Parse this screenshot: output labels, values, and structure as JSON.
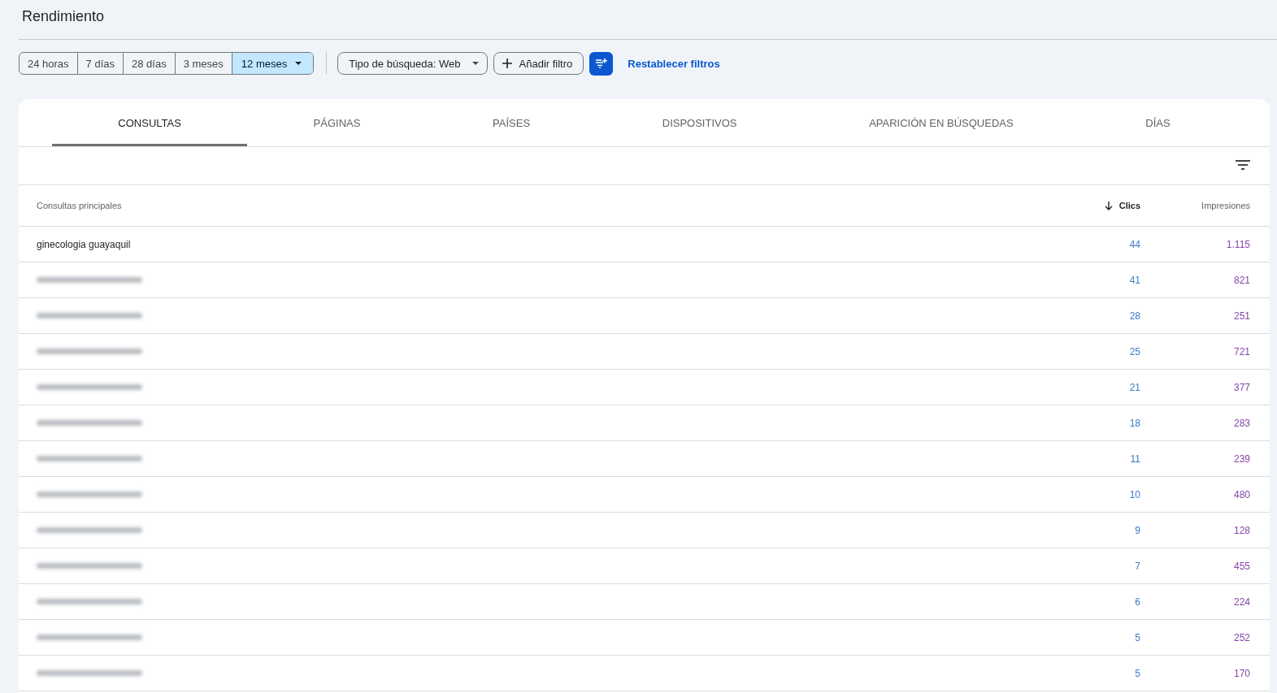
{
  "page": {
    "title": "Rendimiento"
  },
  "date_ranges": [
    {
      "label": "24 horas",
      "selected": false
    },
    {
      "label": "7 días",
      "selected": false
    },
    {
      "label": "28 días",
      "selected": false
    },
    {
      "label": "3 meses",
      "selected": false
    },
    {
      "label": "12 meses",
      "selected": true
    }
  ],
  "filters": [
    {
      "kind": "dropdown",
      "label": "Tipo de búsqueda: Web"
    },
    {
      "kind": "add",
      "label": "Añadir filtro"
    }
  ],
  "reset_link": "Restablecer filtros",
  "tabs": [
    {
      "label": "CONSULTAS",
      "selected": true
    },
    {
      "label": "PÁGINAS",
      "selected": false
    },
    {
      "label": "PAÍSES",
      "selected": false
    },
    {
      "label": "DISPOSITIVOS",
      "selected": false
    },
    {
      "label": "APARICIÓN EN BÚSQUEDAS",
      "selected": false
    },
    {
      "label": "DÍAS",
      "selected": false
    }
  ],
  "table": {
    "columns": [
      {
        "label": "Consultas principales",
        "sorted": false
      },
      {
        "label": "Clics",
        "sorted": true
      },
      {
        "label": "Impresiones",
        "sorted": false
      }
    ],
    "rows": [
      {
        "query": "ginecologia guayaquil",
        "blurred": false,
        "clicks": "44",
        "impressions": "1.115"
      },
      {
        "blurred": true,
        "clicks": "41",
        "impressions": "821"
      },
      {
        "blurred": true,
        "clicks": "28",
        "impressions": "251"
      },
      {
        "blurred": true,
        "clicks": "25",
        "impressions": "721"
      },
      {
        "blurred": true,
        "clicks": "21",
        "impressions": "377"
      },
      {
        "blurred": true,
        "clicks": "18",
        "impressions": "283"
      },
      {
        "blurred": true,
        "clicks": "11",
        "impressions": "239"
      },
      {
        "blurred": true,
        "clicks": "10",
        "impressions": "480"
      },
      {
        "blurred": true,
        "clicks": "9",
        "impressions": "128"
      },
      {
        "blurred": true,
        "clicks": "7",
        "impressions": "455"
      },
      {
        "blurred": true,
        "clicks": "6",
        "impressions": "224"
      },
      {
        "blurred": true,
        "clicks": "5",
        "impressions": "252"
      },
      {
        "blurred": true,
        "clicks": "5",
        "impressions": "170"
      }
    ]
  }
}
